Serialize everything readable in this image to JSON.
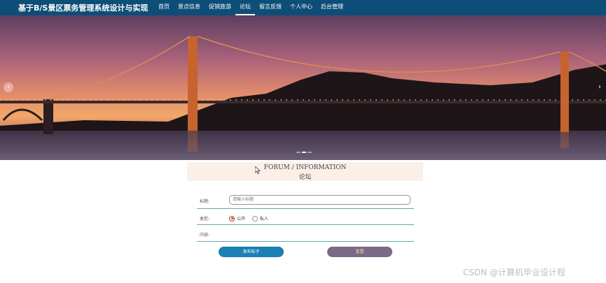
{
  "header": {
    "title": "基于B/S景区票务管理系统设计与实现",
    "nav": [
      "首页",
      "景点信息",
      "促销旅游",
      "论坛",
      "留言反馈",
      "个人中心",
      "后台管理"
    ],
    "active_nav": "论坛"
  },
  "banner": {
    "prev_icon": "chevron-left-icon",
    "next_icon": "chevron-right-icon",
    "dot_count": 3,
    "active_dot": 1
  },
  "forum": {
    "title_en": "FORUM / INFORMATION",
    "title_cn": "论坛"
  },
  "form": {
    "title_label": "标题:",
    "title_placeholder": "请输入标题",
    "type_label": "类型:",
    "type_options": [
      "公开",
      "私人"
    ],
    "type_selected": "公开",
    "content_label": "内容:",
    "submit_label": "发布帖子",
    "reset_label": "重置"
  },
  "watermark": "CSDN @计算机毕业设计程",
  "colors": {
    "nav_bg": "#0d4e78",
    "submit": "#1a7fb3",
    "reset": "#7a6a86",
    "forum_head_bg": "#fcefe7"
  }
}
